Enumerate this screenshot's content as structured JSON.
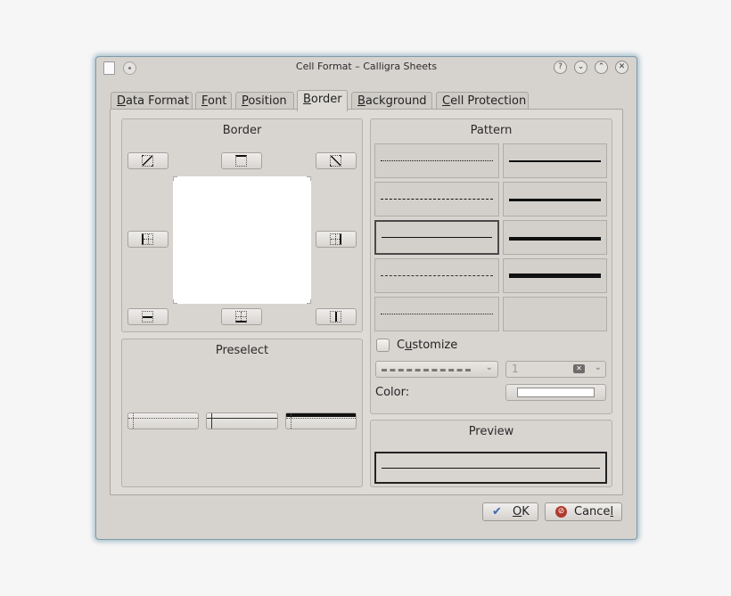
{
  "window": {
    "title": "Cell Format – Calligra Sheets"
  },
  "titlebar_buttons": {
    "help": "?",
    "minimize": "⌄",
    "maximize": "⌃",
    "close": "✕"
  },
  "tabs": [
    {
      "label_pre": "",
      "label_acc": "D",
      "label_post": "ata Format"
    },
    {
      "label_pre": "",
      "label_acc": "F",
      "label_post": "ont"
    },
    {
      "label_pre": "",
      "label_acc": "P",
      "label_post": "osition"
    },
    {
      "label_pre": "",
      "label_acc": "B",
      "label_post": "order"
    },
    {
      "label_pre": "",
      "label_acc": "B",
      "label_post": "ackground"
    },
    {
      "label_pre": "",
      "label_acc": "C",
      "label_post": "ell Protection"
    }
  ],
  "active_tab": "Border",
  "border_group": {
    "title": "Border"
  },
  "preselect_group": {
    "title": "Preselect"
  },
  "pattern_group": {
    "title": "Pattern"
  },
  "customize": {
    "label_pre": "C",
    "label_acc": "u",
    "label_post": "stomize",
    "checked": false
  },
  "width_spin": {
    "value": "1"
  },
  "color": {
    "label": "Color:",
    "value": "#ffffff"
  },
  "preview_group": {
    "title": "Preview"
  },
  "buttons": {
    "ok": {
      "label_acc": "O",
      "label_post": "K"
    },
    "cancel": {
      "label_pre": "Cance",
      "label_acc": "l"
    }
  },
  "icons": [
    "document-icon",
    "window-menu-icon",
    "help-icon",
    "minimize-icon",
    "maximize-icon",
    "close-icon",
    "checkmark-icon",
    "cancel-icon",
    "clear-icon",
    "chevron-down-icon"
  ]
}
